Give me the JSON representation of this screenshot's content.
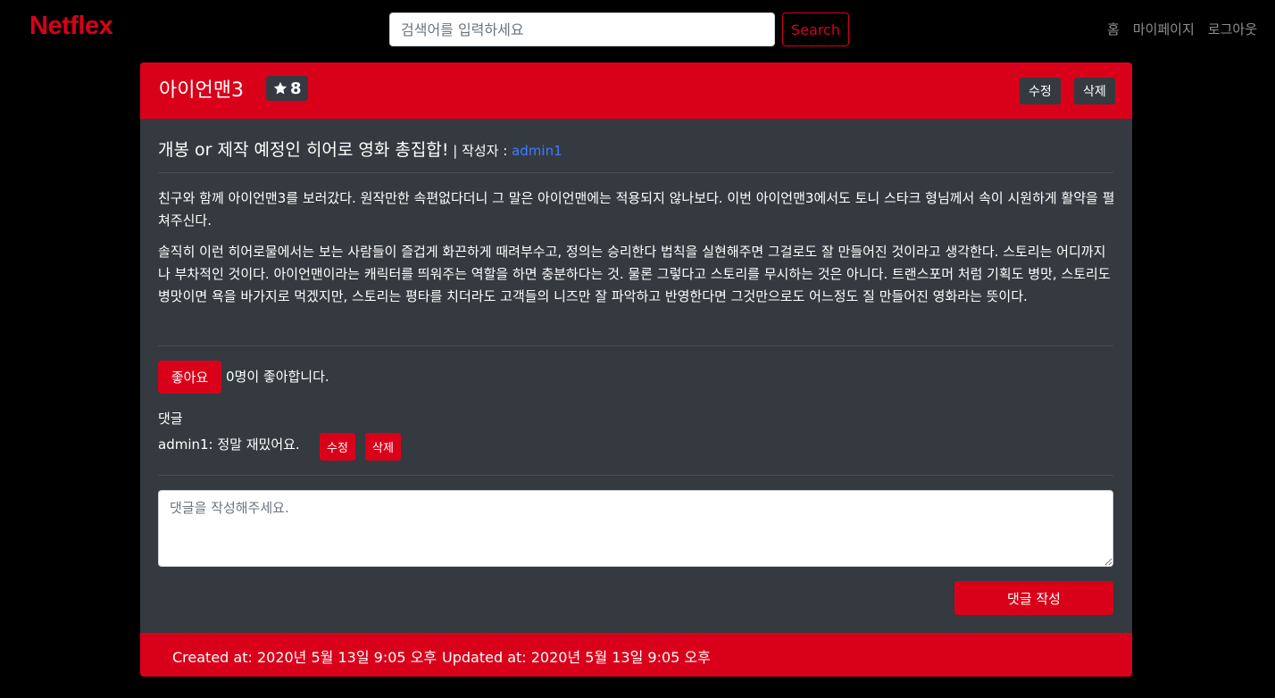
{
  "navbar": {
    "brand": "Netflex",
    "search_placeholder": "검색어를 입력하세요",
    "search_button": "Search",
    "links": [
      "홈",
      "마이페이지",
      "로그아웃"
    ]
  },
  "review": {
    "movie_title": "아이언맨3",
    "rating": "8",
    "edit_label": "수정",
    "delete_label": "삭제",
    "title": "개봉 or 제작 예정인 히어로 영화 총집합!",
    "author_prefix": " | 작성자 : ",
    "author": "admin1",
    "paragraphs": [
      "친구와 함께 아이언맨3를 보러갔다. 원작만한 속편없다더니 그 말은 아이언맨에는 적용되지 않나보다. 이번 아이언맨3에서도 토니 스타크 형님께서 속이 시원하게 활약을 펼쳐주신다.",
      "솔직히 이런 히어로물에서는 보는 사람들이 즐겁게 화끈하게 때려부수고, 정의는 승리한다 법칙을 실현해주면 그걸로도 잘 만들어진 것이라고 생각한다. 스토리는 어디까지나 부차적인 것이다. 아이언맨이라는 캐릭터를 띄워주는 역할을 하면 충분하다는 것. 물론 그렇다고 스토리를 무시하는 것은 아니다. 트랜스포머 처럼 기획도 병맛, 스토리도 병맛이면 욕을 바가지로 먹겠지만, 스토리는 평타를 치더라도 고객들의 니즈만 잘 파악하고 반영한다면 그것만으로도 어느정도 질 만들어진 영화라는 뜻이다."
    ],
    "like_button": "좋아요",
    "like_count_text": "0명이 좋아합니다."
  },
  "comments": {
    "label": "댓글",
    "items": [
      {
        "text": "admin1: 정말 재밌어요.",
        "edit_label": "수정",
        "delete_label": "삭제"
      }
    ],
    "placeholder": "댓글을 작성해주세요.",
    "submit_label": "댓글 작성"
  },
  "footer": {
    "created": "Created at: 2020년 5월 13일 9:05 오후",
    "updated": "Updated at: 2020년 5월 13일 9:05 오후"
  },
  "colors": {
    "accent": "#d9001a",
    "card_bg": "#343a40",
    "link": "#3d7dff"
  }
}
